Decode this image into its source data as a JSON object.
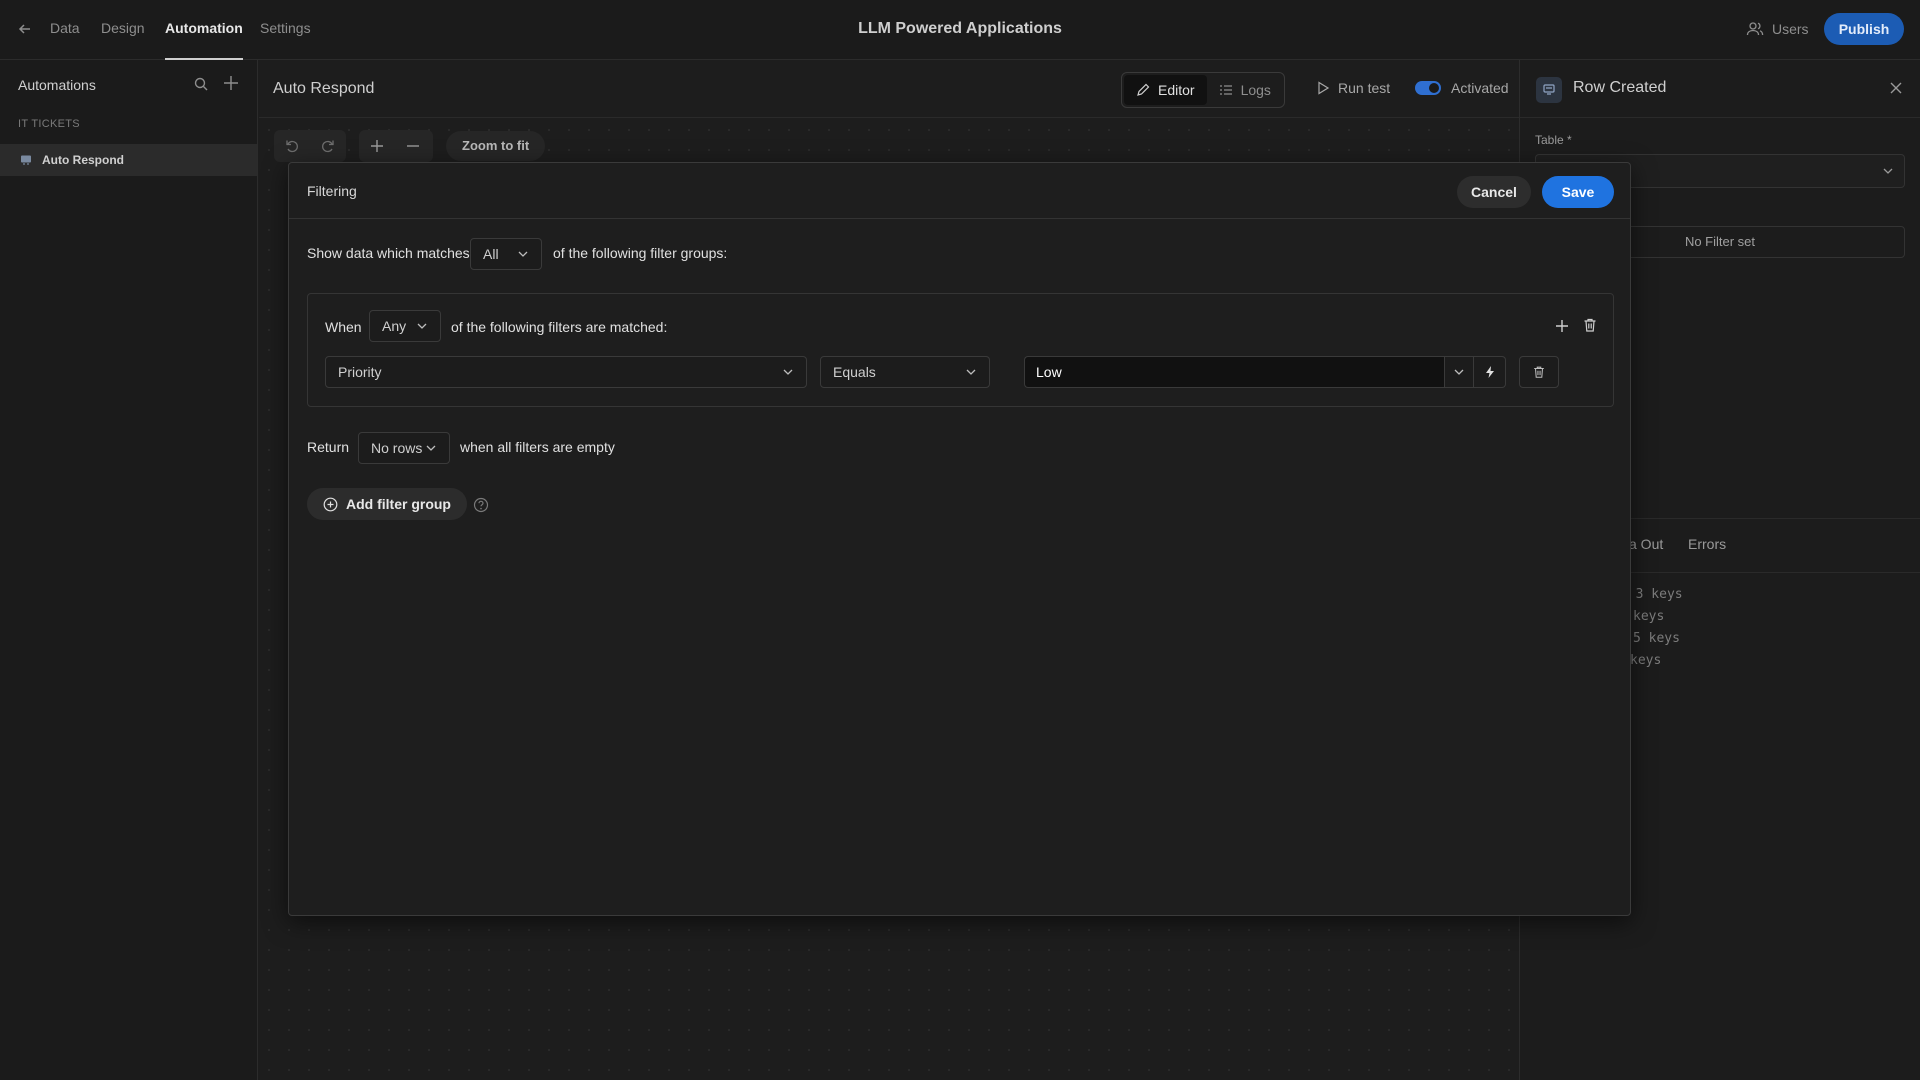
{
  "topbar": {
    "tabs": [
      {
        "label": "Data"
      },
      {
        "label": "Design"
      },
      {
        "label": "Automation"
      },
      {
        "label": "Settings"
      }
    ],
    "app_title": "LLM Powered Applications",
    "users_label": "Users",
    "publish_label": "Publish"
  },
  "sidebar": {
    "title": "Automations",
    "group": "IT TICKETS",
    "items": [
      {
        "label": "Auto Respond"
      }
    ]
  },
  "canvas": {
    "automation_name": "Auto Respond",
    "editor_label": "Editor",
    "logs_label": "Logs",
    "run_test_label": "Run test",
    "activated_label": "Activated",
    "zoom_fit_label": "Zoom to fit"
  },
  "right_panel": {
    "title": "Row Created",
    "table_label": "Table *",
    "no_filter_label": "No Filter set",
    "tab_data_out": "a Out",
    "tab_errors": "Errors",
    "keys": [
      "- 3 keys",
      "keys",
      "5 keys",
      "keys"
    ]
  },
  "modal": {
    "title": "Filtering",
    "cancel_label": "Cancel",
    "save_label": "Save",
    "match_prefix": "Show data which matches",
    "match_value": "All",
    "match_suffix": "of the following filter groups:",
    "group": {
      "when_label": "When",
      "any_value": "Any",
      "suffix": "of the following filters are matched:",
      "filter": {
        "field": "Priority",
        "operator": "Equals",
        "value": "Low"
      }
    },
    "return_label": "Return",
    "return_value": "No rows",
    "return_suffix": "when all filters are empty",
    "add_group_label": "Add filter group"
  },
  "colors": {
    "accent": "#1f73e0",
    "publish": "#1c5cb4",
    "toggle_on": "#2f6fd1"
  }
}
